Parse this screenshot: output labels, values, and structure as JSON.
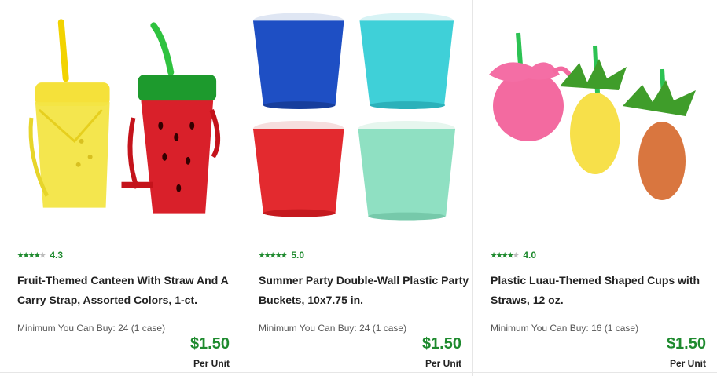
{
  "products": [
    {
      "rating": "4.3",
      "stars_filled": 4,
      "title": "Fruit-Themed Canteen With Straw And A Carry Strap, Assorted Colors, 1-ct.",
      "min_buy": "Minimum You Can Buy: 24 (1 case)",
      "price": "$1.50",
      "per_unit": "Per Unit"
    },
    {
      "rating": "5.0",
      "stars_filled": 5,
      "title": "Summer Party Double-Wall Plastic Party Buckets, 10x7.75 in.",
      "min_buy": "Minimum You Can Buy: 24 (1 case)",
      "price": "$1.50",
      "per_unit": "Per Unit"
    },
    {
      "rating": "4.0",
      "stars_filled": 4,
      "title": "Plastic Luau-Themed Shaped Cups with Straws, 12 oz.",
      "min_buy": "Minimum You Can Buy: 16 (1 case)",
      "price": "$1.50",
      "per_unit": "Per Unit"
    }
  ],
  "colors": {
    "accent_green": "#1e8a2e"
  }
}
